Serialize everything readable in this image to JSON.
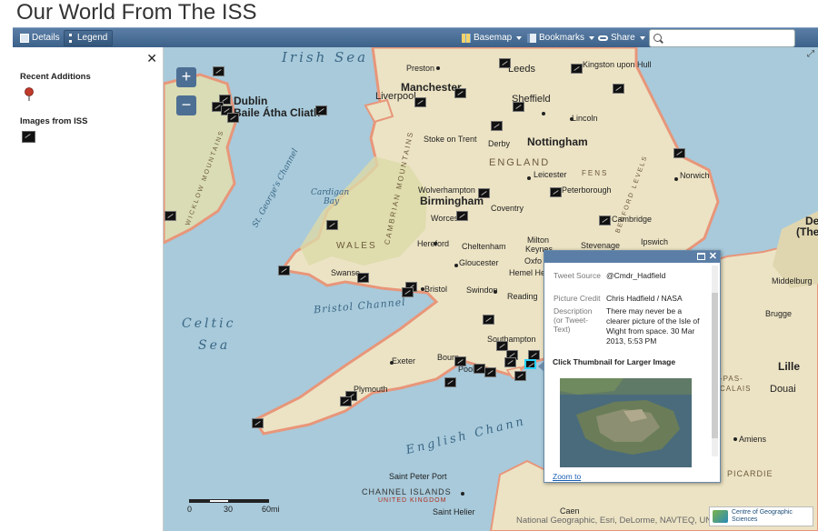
{
  "app": {
    "title": "Our World From The ISS"
  },
  "toolbar": {
    "details_label": "Details",
    "legend_label": "Legend",
    "basemap_label": "Basemap",
    "bookmarks_label": "Bookmarks",
    "share_label": "Share",
    "search_value": "",
    "search_placeholder": ""
  },
  "sidebar": {
    "close_glyph": "✕",
    "recent_label": "Recent Additions",
    "images_label": "Images from ISS"
  },
  "map": {
    "zoom_in": "+",
    "zoom_out": "−",
    "expand_glyph": "⤢",
    "seas": {
      "irish_sea": "Irish Sea",
      "celtic_sea_1": "Celtic",
      "celtic_sea_2": "Sea",
      "bristol_channel": "Bristol Channel",
      "english_channel": "English Chann",
      "st_georges_channel": "St. George's Channel",
      "cardigan_bay_1": "Cardigan",
      "cardigan_bay_2": "Bay"
    },
    "regions": {
      "wales": "WALES",
      "england": "ENGLAND",
      "cambrian": "CAMBRIAN MOUNTAINS",
      "wicklow": "WICKLOW MOUNTAINS",
      "fens": "FENS",
      "bedford": "BEDFORD LEVELS",
      "pas_de_calais_1": "-PAS-",
      "pas_de_calais_2": "CALAIS",
      "picardie": "PICARDIE",
      "channel_islands": "CHANNEL ISLANDS",
      "united_kingdom": "UNITED KINGDOM"
    },
    "places": {
      "dublin": "Dublin",
      "baile": "Baile Átha Cliath",
      "preston": "Preston",
      "leeds": "Leeds",
      "kingston": "Kingston upon Hull",
      "manchester": "Manchester",
      "liverpool": "Liverpool",
      "sheffield": "Sheffield",
      "lincoln": "Lincoln",
      "stoke": "Stoke on Trent",
      "derby": "Derby",
      "nottingham": "Nottingham",
      "norwich": "Norwich",
      "leicester": "Leicester",
      "peterborough": "Peterborough",
      "wolverhampton": "Wolverhampton",
      "birmingham": "Birmingham",
      "coventry": "Coventry",
      "worcester": "Worces",
      "cambridge": "Cambridge",
      "ipswich": "Ipswich",
      "hereford": "Hereford",
      "cheltenham": "Cheltenham",
      "milton": "Milton",
      "keynes": "Keynes",
      "stevenage": "Stevenage",
      "gloucester": "Gloucester",
      "oxford": "Oxfo",
      "hemel": "Hemel He",
      "swansea": "Swanse",
      "bristol": "Bristol",
      "swindon": "Swindon",
      "reading": "Reading",
      "southampton": "Southampton",
      "exeter": "Exeter",
      "bournemouth": "Bourn",
      "poole": "Poole",
      "plymouth": "Plymouth",
      "saint_peter_port": "Saint Peter Port",
      "saint_helier": "Saint Helier",
      "caen": "Caen",
      "middelburg": "Middelburg",
      "brugge": "Brugge",
      "lille": "Lille",
      "douai": "Douai",
      "amiens": "Amiens",
      "de": "De",
      "the": "(The"
    },
    "scale": {
      "zero": "0",
      "thirty": "30",
      "sixty": "60mi"
    },
    "attribution": "National Geographic, Esri, DeLorme, NAVTEQ, UNEP-WCMC, USGS...",
    "logo_text": "Centre of Geographic Sciences"
  },
  "popup": {
    "close_glyph": "✕",
    "tweet_source_key": "Tweet Source",
    "tweet_source_val": "@Cmdr_Hadfield",
    "picture_credit_key": "Picture Credit",
    "picture_credit_val": "Chris Hadfield / NASA",
    "description_key": "Description (or Tweet-Text)",
    "description_val": "There may never be a clearer picture of the Isle of Wight from space. 30 Mar 2013, 5:53 PM",
    "thumb_label": "Click Thumbnail for Larger Image",
    "zoom_label": "Zoom to"
  },
  "colors": {
    "toolbar": "#4a6d94",
    "sea": "#a8cadb",
    "land": "#ece3c4",
    "coast": "#e8967a",
    "selection": "#2ad4ff"
  }
}
